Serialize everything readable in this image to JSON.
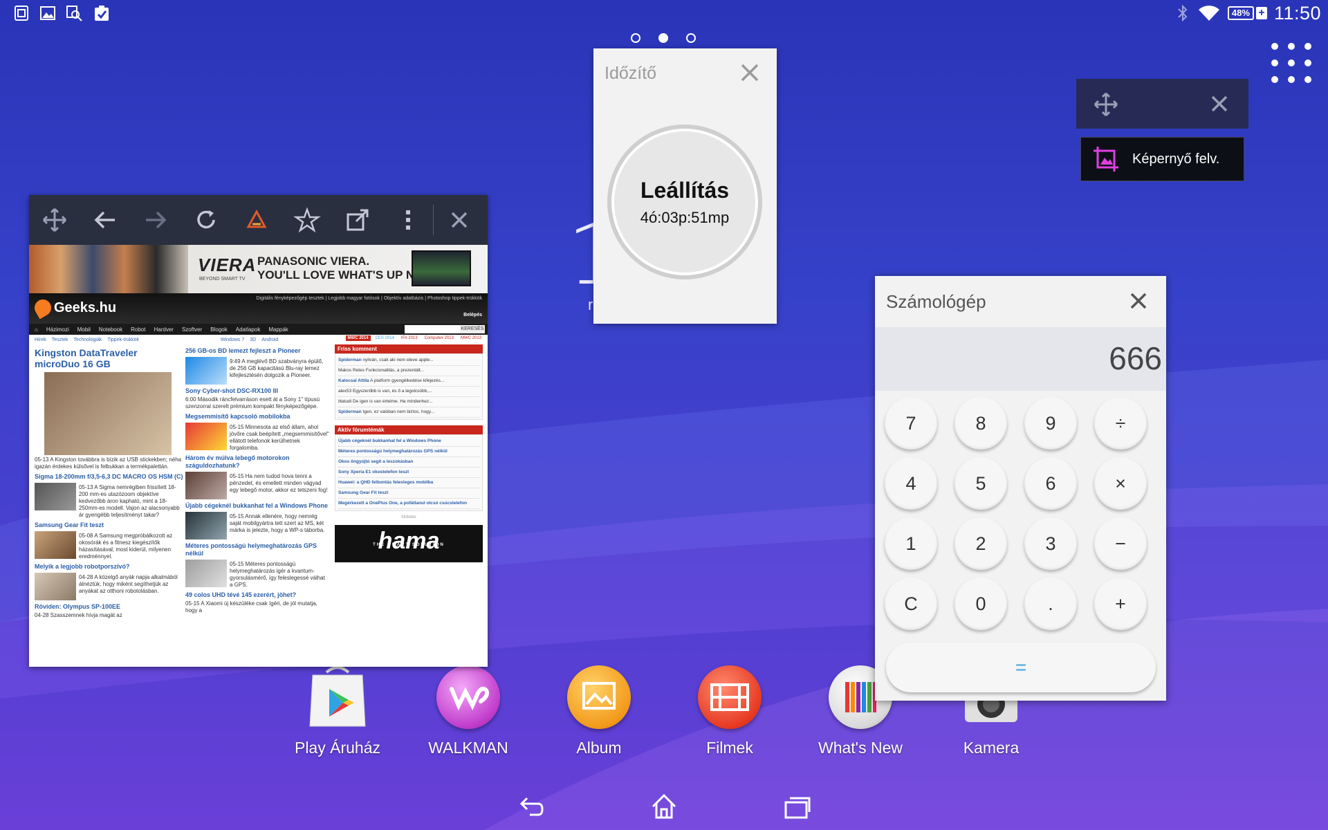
{
  "status_bar": {
    "notification_icons": [
      "document-icon",
      "image-icon",
      "search-image-icon",
      "clipboard-check-icon"
    ],
    "battery_percent": "48%",
    "clock": "11:50"
  },
  "home": {
    "page_dots": [
      {
        "active": false
      },
      {
        "active": true
      },
      {
        "active": false
      }
    ],
    "clock_fragment": "1",
    "clock_small_fragment": "r"
  },
  "mini_browser": {
    "ad": {
      "brand": "VIERA",
      "brand_sub": "BEYOND SMART TV",
      "headline_1": "PANASONIC VIERA.",
      "headline_2": "YOU'LL LOVE WHAT'S UP NEXT."
    },
    "site": {
      "logo": "Geeks.hu",
      "toplinks": "Digitális fényképezőgép tesztek | Legjobb magyar fotósok | Objektív adatbázis | Photoshop tippek-trükkök",
      "login": "Belépés",
      "nav": [
        "Házimozi",
        "Mobil",
        "Notebook",
        "Robot",
        "Hardver",
        "Szoftver",
        "Blogok",
        "Adatlapok",
        "Mappák"
      ],
      "search_button": "KERESÉS",
      "subnav": [
        "Hírek",
        "Tesztek",
        "Technológiák",
        "Tippek-trükkök"
      ],
      "subnav_right": [
        "Windows 7",
        "3D",
        "Android"
      ],
      "tags": [
        "MWC 2014",
        "CES 2014",
        "IFA 2013",
        "Computex 2013",
        "MWC 2013"
      ]
    },
    "col1": [
      {
        "title": "Kingston DataTraveler microDuo 16 GB",
        "text": "05-13 A Kingston továbbra is bízik az USB stickekben; néha igazán érdekes külsővel is felbukkan a termékpalettán."
      },
      {
        "title": "Sigma 18-200mm f/3,5-6,3 DC MACRO OS HSM (C)",
        "text": "05-13 A Sigma nemrégiben frissített 18-200 mm-es utazózoom objektíve kedvezőbb áron kapható, mint a 18-250mm-es modell. Vajon az alacsonyabb ár gyengébb teljesítményt takar?"
      },
      {
        "title": "Samsung Gear Fit teszt",
        "text": "05-08 A Samsung megpróbálkozott az okosórák és a fitnesz kiegészítők házasításával; most kiderül, milyenen eredménnyel."
      },
      {
        "title": "Melyik a legjobb robotporszívó?",
        "text": "04-28 A közelgő anyák napja alkalmából átnéztük, hogy miként segíthetjük az anyákat az otthoni robotolásban."
      },
      {
        "title": "Röviden: Olympus SP-100EE",
        "text": "04-28 Szasszemnek hívja magát az"
      }
    ],
    "col2": [
      {
        "title": "256 GB-os BD lemezt fejleszt a Pioneer",
        "text": "9:49 A meglévő BD szabványra épülő, de 256 GB kapacitású Blu-ray lemez kifejlesztésén dolgozik a Pioneer."
      },
      {
        "title": "Sony Cyber-shot DSC-RX100 III",
        "text": "6:00 Második ráncfelvarráson esett át a Sony 1\" típusú szenzorral szerelt prémium kompakt fényképezőgépe."
      },
      {
        "title": "Megsemmisítő kapcsoló mobilokba",
        "text": "05-15 Minnesota az első állam, ahol jövőre csak beépített „megsemmisítővel\" ellátott telefonok kerülhetnek forgalomba."
      },
      {
        "title": "Három év múlva lebegő motorokon száguldozhatunk?",
        "text": "05-15 Ha nem tudod hova tenni a pénzedet, és emellett minden vágyad egy lebegő motor, akkor ez tetszeni fog!"
      },
      {
        "title": "Újabb cégeknél bukkanhat fel a Windows Phone",
        "text": "05-15 Annak ellenére, hogy nemrég saját mobilgyártra tett szert az MS, két márka is jelezte, hogy a WP-s táborba."
      },
      {
        "title": "Méteres pontosságú helymeghatározás GPS nélkül",
        "text": "05-15 Méteres pontosságú helymeghatározás igér a kvantum-gyorsulásmérő, így feleslegessé válhat a GPS."
      },
      {
        "title": "49 colos UHD tévé 145 ezerért, jöhet?",
        "text": "05-15 A Xiaomi új készüléke csak ígéri, de jól mutatja, hogy a"
      }
    ],
    "col3": {
      "comments_head": "Friss komment",
      "comments": [
        {
          "user": "Spiderman",
          "text": "nyilván, csak aki nem eleve apple..."
        },
        {
          "user": "",
          "text": "Makos Retes Funkcionalitás, a prezentált..."
        },
        {
          "user": "Kalocsai Attila",
          "text": "A platform gyengélkedése kifejezés..."
        },
        {
          "user": "",
          "text": "alex53 Egyszerűbb is van, és ő a legolcsóbb,..."
        },
        {
          "user": "",
          "text": "ittatudi De igen is van értelme. Ha mindenhez..."
        },
        {
          "user": "Spiderman",
          "text": "Igen, ez valóban nem biztos, hogy..."
        }
      ],
      "forum_head": "Aktív fórumtémák",
      "forum": [
        "Újabb cégeknél bukkanhat fel a Windows Phone",
        "Méteres pontosságú helymeghatározás GPS nélkül",
        "Okos öngyújtó segít a leszokásban",
        "Sony Xperia E1 okostelefon teszt",
        "Huawei: a QHD felbontás felesleges mobilba",
        "Samsung Gear Fit teszt",
        "Megérkezett a OnePlus One, a pofátlanul olcsó csúcstelefon"
      ],
      "ad_label": "hirdetés",
      "ad_brand": "hama",
      "ad_slogan": "THE SMART SOLUTION"
    }
  },
  "timer": {
    "title": "Időzítő",
    "label": "Leállítás",
    "time": "4ó:03p:51mp"
  },
  "capture": {
    "label": "Képernyő felv."
  },
  "calculator": {
    "title": "Számológép",
    "display": "666",
    "keys": [
      [
        "7",
        "8",
        "9",
        "÷"
      ],
      [
        "4",
        "5",
        "6",
        "×"
      ],
      [
        "1",
        "2",
        "3",
        "−"
      ],
      [
        "C",
        "0",
        ".",
        "+"
      ]
    ],
    "equals": "="
  },
  "dock": [
    {
      "label": "Play Áruház",
      "icon": "play-store-icon"
    },
    {
      "label": "WALKMAN",
      "icon": "walkman-icon"
    },
    {
      "label": "Album",
      "icon": "album-icon"
    },
    {
      "label": "Filmek",
      "icon": "movies-icon"
    },
    {
      "label": "What's New",
      "icon": "whats-new-icon"
    },
    {
      "label": "Kamera",
      "icon": "camera-icon"
    }
  ],
  "colors": {
    "accent_blue": "#3aa0e6",
    "site_red": "#c9261c",
    "capture_magenta": "#e040e0"
  }
}
